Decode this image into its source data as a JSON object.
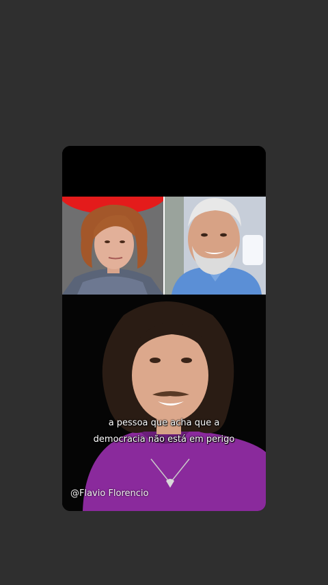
{
  "video": {
    "caption_line_1": "a pessoa que acha que a",
    "caption_line_2": "democracia não está em perigo",
    "handle": "@Flavio Florencio"
  },
  "colors": {
    "background": "#2f2f2f",
    "shirt_purple": "#8a2a9c",
    "left_banner_red": "#e41b1b",
    "right_shirt_blue": "#5b8fd6"
  }
}
